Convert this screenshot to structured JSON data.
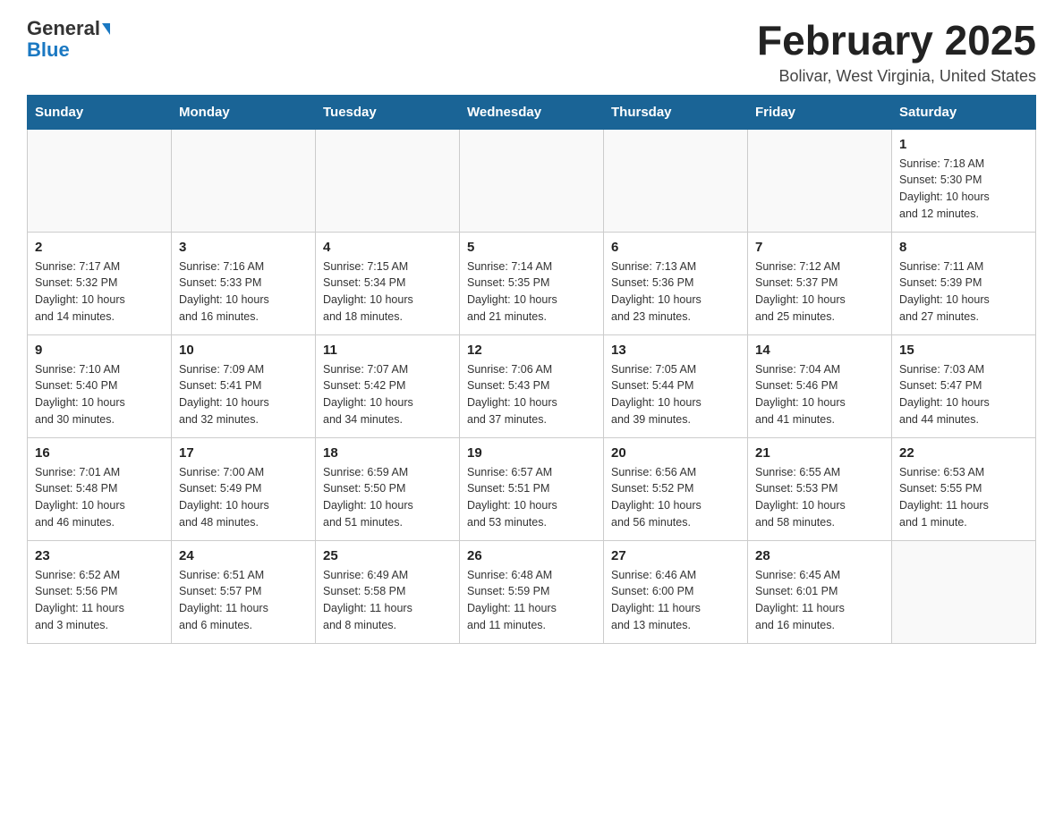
{
  "header": {
    "logo_general": "General",
    "logo_blue": "Blue",
    "month_title": "February 2025",
    "location": "Bolivar, West Virginia, United States"
  },
  "days_of_week": [
    "Sunday",
    "Monday",
    "Tuesday",
    "Wednesday",
    "Thursday",
    "Friday",
    "Saturday"
  ],
  "weeks": [
    [
      {
        "day": "",
        "info": ""
      },
      {
        "day": "",
        "info": ""
      },
      {
        "day": "",
        "info": ""
      },
      {
        "day": "",
        "info": ""
      },
      {
        "day": "",
        "info": ""
      },
      {
        "day": "",
        "info": ""
      },
      {
        "day": "1",
        "info": "Sunrise: 7:18 AM\nSunset: 5:30 PM\nDaylight: 10 hours\nand 12 minutes."
      }
    ],
    [
      {
        "day": "2",
        "info": "Sunrise: 7:17 AM\nSunset: 5:32 PM\nDaylight: 10 hours\nand 14 minutes."
      },
      {
        "day": "3",
        "info": "Sunrise: 7:16 AM\nSunset: 5:33 PM\nDaylight: 10 hours\nand 16 minutes."
      },
      {
        "day": "4",
        "info": "Sunrise: 7:15 AM\nSunset: 5:34 PM\nDaylight: 10 hours\nand 18 minutes."
      },
      {
        "day": "5",
        "info": "Sunrise: 7:14 AM\nSunset: 5:35 PM\nDaylight: 10 hours\nand 21 minutes."
      },
      {
        "day": "6",
        "info": "Sunrise: 7:13 AM\nSunset: 5:36 PM\nDaylight: 10 hours\nand 23 minutes."
      },
      {
        "day": "7",
        "info": "Sunrise: 7:12 AM\nSunset: 5:37 PM\nDaylight: 10 hours\nand 25 minutes."
      },
      {
        "day": "8",
        "info": "Sunrise: 7:11 AM\nSunset: 5:39 PM\nDaylight: 10 hours\nand 27 minutes."
      }
    ],
    [
      {
        "day": "9",
        "info": "Sunrise: 7:10 AM\nSunset: 5:40 PM\nDaylight: 10 hours\nand 30 minutes."
      },
      {
        "day": "10",
        "info": "Sunrise: 7:09 AM\nSunset: 5:41 PM\nDaylight: 10 hours\nand 32 minutes."
      },
      {
        "day": "11",
        "info": "Sunrise: 7:07 AM\nSunset: 5:42 PM\nDaylight: 10 hours\nand 34 minutes."
      },
      {
        "day": "12",
        "info": "Sunrise: 7:06 AM\nSunset: 5:43 PM\nDaylight: 10 hours\nand 37 minutes."
      },
      {
        "day": "13",
        "info": "Sunrise: 7:05 AM\nSunset: 5:44 PM\nDaylight: 10 hours\nand 39 minutes."
      },
      {
        "day": "14",
        "info": "Sunrise: 7:04 AM\nSunset: 5:46 PM\nDaylight: 10 hours\nand 41 minutes."
      },
      {
        "day": "15",
        "info": "Sunrise: 7:03 AM\nSunset: 5:47 PM\nDaylight: 10 hours\nand 44 minutes."
      }
    ],
    [
      {
        "day": "16",
        "info": "Sunrise: 7:01 AM\nSunset: 5:48 PM\nDaylight: 10 hours\nand 46 minutes."
      },
      {
        "day": "17",
        "info": "Sunrise: 7:00 AM\nSunset: 5:49 PM\nDaylight: 10 hours\nand 48 minutes."
      },
      {
        "day": "18",
        "info": "Sunrise: 6:59 AM\nSunset: 5:50 PM\nDaylight: 10 hours\nand 51 minutes."
      },
      {
        "day": "19",
        "info": "Sunrise: 6:57 AM\nSunset: 5:51 PM\nDaylight: 10 hours\nand 53 minutes."
      },
      {
        "day": "20",
        "info": "Sunrise: 6:56 AM\nSunset: 5:52 PM\nDaylight: 10 hours\nand 56 minutes."
      },
      {
        "day": "21",
        "info": "Sunrise: 6:55 AM\nSunset: 5:53 PM\nDaylight: 10 hours\nand 58 minutes."
      },
      {
        "day": "22",
        "info": "Sunrise: 6:53 AM\nSunset: 5:55 PM\nDaylight: 11 hours\nand 1 minute."
      }
    ],
    [
      {
        "day": "23",
        "info": "Sunrise: 6:52 AM\nSunset: 5:56 PM\nDaylight: 11 hours\nand 3 minutes."
      },
      {
        "day": "24",
        "info": "Sunrise: 6:51 AM\nSunset: 5:57 PM\nDaylight: 11 hours\nand 6 minutes."
      },
      {
        "day": "25",
        "info": "Sunrise: 6:49 AM\nSunset: 5:58 PM\nDaylight: 11 hours\nand 8 minutes."
      },
      {
        "day": "26",
        "info": "Sunrise: 6:48 AM\nSunset: 5:59 PM\nDaylight: 11 hours\nand 11 minutes."
      },
      {
        "day": "27",
        "info": "Sunrise: 6:46 AM\nSunset: 6:00 PM\nDaylight: 11 hours\nand 13 minutes."
      },
      {
        "day": "28",
        "info": "Sunrise: 6:45 AM\nSunset: 6:01 PM\nDaylight: 11 hours\nand 16 minutes."
      },
      {
        "day": "",
        "info": ""
      }
    ]
  ]
}
